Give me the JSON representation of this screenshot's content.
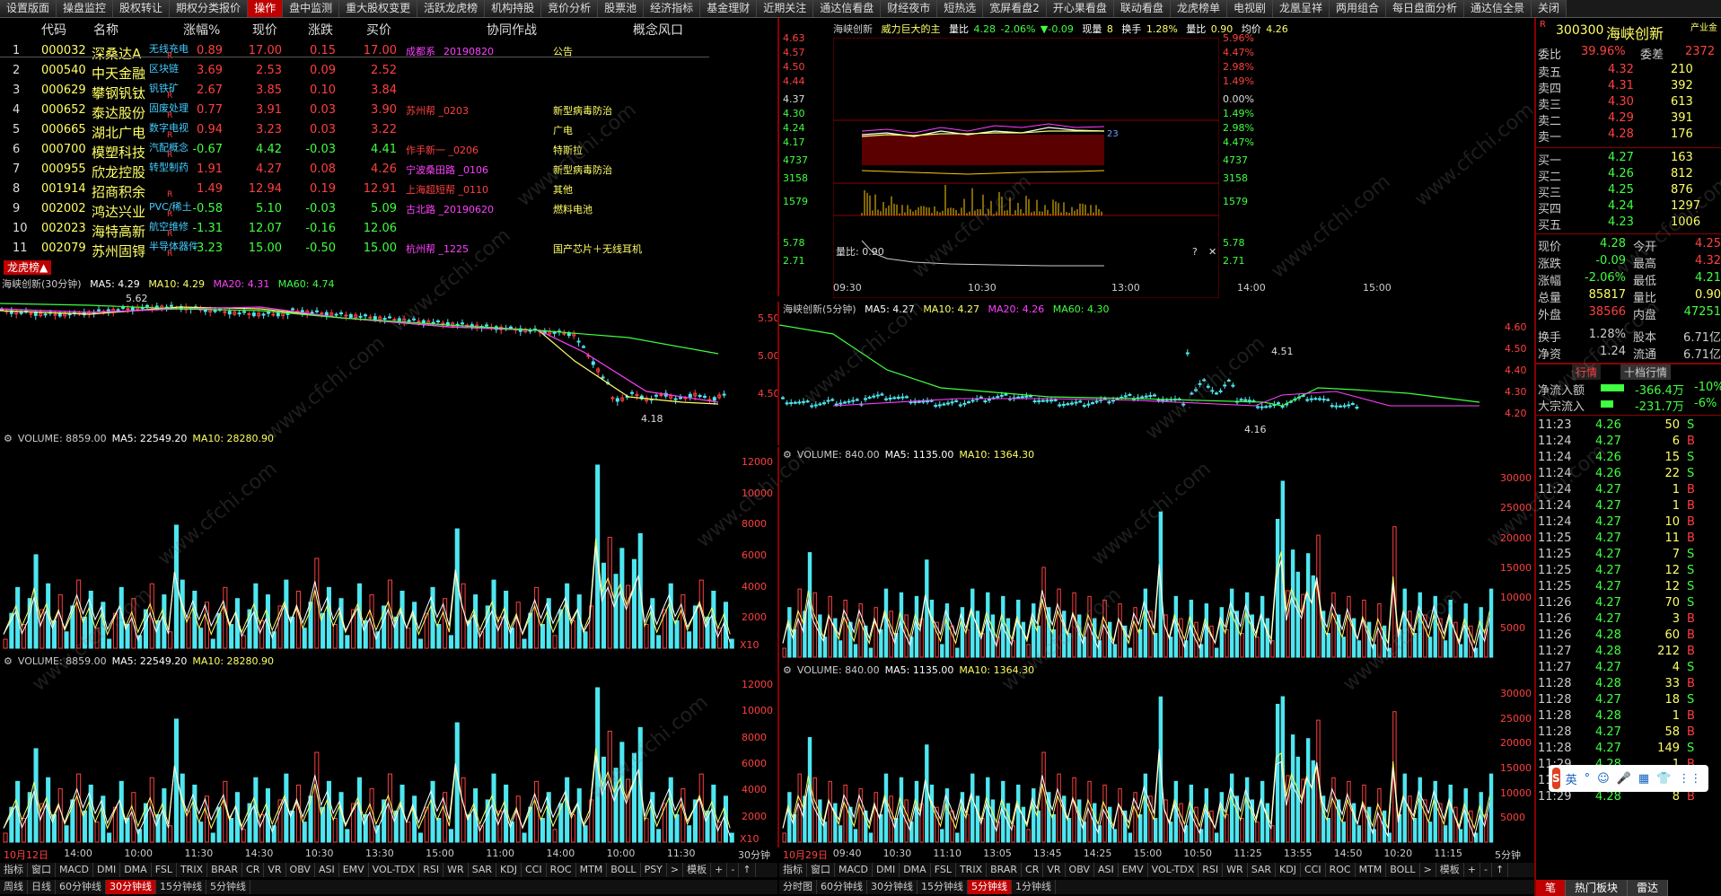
{
  "topbar": [
    "设置版面",
    "操盘监控",
    "股权转让",
    "期权分类报价",
    "操作",
    "盘中监测",
    "重大股权变更",
    "活跃龙虎榜",
    "机构持股",
    "竞价分析",
    "股票池",
    "经济指标",
    "基金理财",
    "近期关注",
    "通达信看盘",
    "财经夜市",
    "短热选",
    "宽屏看盘2",
    "开心果看盘",
    "联动看盘",
    "龙虎榜单",
    "电视剧",
    "龙凰呈祥",
    "两用组合",
    "每日盘面分析",
    "通达信全景",
    "关闭"
  ],
  "lhb": {
    "headers": [
      "代码",
      "名称",
      "涨幅%",
      "现价",
      "涨跌",
      "买价",
      "协同作战",
      "概念风口"
    ],
    "rows": [
      {
        "i": "1",
        "code": "000032",
        "name": "深桑达A",
        "note": "无线充电",
        "r": "R",
        "pct": "0.89",
        "px": "17.00",
        "chg": "0.15",
        "bid": "17.00",
        "syn": "成都系 _20190820",
        "con": "公告",
        "c": "up"
      },
      {
        "i": "2",
        "code": "000540",
        "name": "中天金融",
        "note": "区块链",
        "r": "",
        "pct": "3.69",
        "px": "2.53",
        "chg": "0.09",
        "bid": "2.52",
        "syn": "",
        "con": "",
        "c": "up"
      },
      {
        "i": "3",
        "code": "000629",
        "name": "攀钢钒钛",
        "note": "钒铁矿",
        "r": "R",
        "pct": "2.67",
        "px": "3.85",
        "chg": "0.10",
        "bid": "3.84",
        "syn": "",
        "con": "",
        "c": "up"
      },
      {
        "i": "4",
        "code": "000652",
        "name": "泰达股份",
        "note": "固废处理",
        "r": "R",
        "pct": "0.77",
        "px": "3.91",
        "chg": "0.03",
        "bid": "3.90",
        "syn": "苏州帮 _0203",
        "con": "新型病毒防治",
        "c": "up"
      },
      {
        "i": "5",
        "code": "000665",
        "name": "湖北广电",
        "note": "数字电视",
        "r": "R",
        "pct": "0.94",
        "px": "3.23",
        "chg": "0.03",
        "bid": "3.22",
        "syn": "",
        "con": "广电",
        "c": "up"
      },
      {
        "i": "6",
        "code": "000700",
        "name": "模塑科技",
        "note": "汽配概念",
        "r": "R",
        "pct": "-0.67",
        "px": "4.42",
        "chg": "-0.03",
        "bid": "4.41",
        "syn": "作手新一 _0206",
        "con": "特斯拉",
        "c": "dn"
      },
      {
        "i": "7",
        "code": "000955",
        "name": "欣龙控股",
        "note": "转型制药",
        "r": "",
        "pct": "1.91",
        "px": "4.27",
        "chg": "0.08",
        "bid": "4.26",
        "syn": "宁波桑田路 _0106",
        "con": "新型病毒防治",
        "c": "up"
      },
      {
        "i": "8",
        "code": "001914",
        "name": "招商积余",
        "note": "",
        "r": "R",
        "pct": "1.49",
        "px": "12.94",
        "chg": "0.19",
        "bid": "12.91",
        "syn": "上海超短帮 _0110",
        "con": "其他",
        "c": "up"
      },
      {
        "i": "9",
        "code": "002002",
        "name": "鸿达兴业",
        "note": "PVC/稀土",
        "r": "R",
        "pct": "-0.58",
        "px": "5.10",
        "chg": "-0.03",
        "bid": "5.09",
        "syn": "古北路 _20190620",
        "con": "燃料电池",
        "c": "dn"
      },
      {
        "i": "10",
        "code": "002023",
        "name": "海特高新",
        "note": "航空维修",
        "r": "R",
        "pct": "-1.31",
        "px": "12.07",
        "chg": "-0.16",
        "bid": "12.06",
        "syn": "",
        "con": "",
        "c": "dn"
      },
      {
        "i": "11",
        "code": "002079",
        "name": "苏州固锝",
        "note": "半导体器件",
        "r": "R",
        "pct": "-3.23",
        "px": "15.00",
        "chg": "-0.50",
        "bid": "15.00",
        "syn": "杭州帮 _1225",
        "con": "国产芯片＋无线耳机",
        "c": "dn"
      }
    ],
    "tag": "龙虎榜▲"
  },
  "intraday": {
    "title": "海峡创新",
    "subtitle": "威力巨大的主",
    "vr_label": "量比",
    "price": "4.28",
    "pct": "-2.06%",
    "chg": "▼-0.09",
    "cur_vol_label": "现量",
    "cur_vol": "8",
    "turn_label": "换手",
    "turn": "1.28%",
    "vr_label2": "量比",
    "vr": "0.90",
    "avg_label": "均价",
    "avg": "4.26",
    "left_axis": [
      "4.63",
      "4.57",
      "4.50",
      "4.44",
      "4.37",
      "4.30",
      "4.24",
      "4.17",
      "4737",
      "3158",
      "1579",
      "5.78",
      "2.71"
    ],
    "right_axis": [
      "5.96%",
      "4.47%",
      "2.98%",
      "1.49%",
      "0.00%",
      "1.49%",
      "2.98%",
      "4.47%",
      "4737",
      "3158",
      "1579",
      "5.78",
      "2.71"
    ],
    "vr_title": "量比: 0.90",
    "help": "?",
    "close": "✕",
    "times": [
      "09:30",
      "10:30",
      "13:00",
      "14:00",
      "15:00"
    ],
    "marker": "23"
  },
  "k30": {
    "title": "海峡创新(30分钟)",
    "ma5": "MA5: 4.29",
    "ma10": "MA10: 4.29",
    "ma20": "MA20: 4.31",
    "ma60": "MA60: 4.74",
    "axis": [
      "5.50",
      "5.00",
      "4.50"
    ],
    "hi": "5.62",
    "lo": "4.18"
  },
  "k5": {
    "title": "海峡创新(5分钟)",
    "ma5": "MA5: 4.27",
    "ma10": "MA10: 4.27",
    "ma20": "MA20: 4.26",
    "ma60": "MA60: 4.30",
    "axis": [
      "4.60",
      "4.50",
      "4.40",
      "4.30",
      "4.20"
    ],
    "hi": "4.51",
    "lo": "4.16"
  },
  "vol30": {
    "label": "VOLUME: 8859.00",
    "ma5": "MA5: 22549.20",
    "ma10": "MA10: 28280.90",
    "axis": [
      "12000",
      "10000",
      "8000",
      "6000",
      "4000",
      "2000"
    ],
    "unit": "X10"
  },
  "vol5": {
    "label": "VOLUME: 840.00",
    "ma5": "MA5: 1135.00",
    "ma10": "MA10: 1364.30",
    "axis": [
      "30000",
      "25000",
      "20000",
      "15000",
      "10000",
      "5000"
    ]
  },
  "left_time": [
    "10月12日",
    "14:00",
    "10:00",
    "11:30",
    "14:30",
    "10:30",
    "13:30",
    "15:00",
    "11:00",
    "14:00",
    "10:00",
    "11:30"
  ],
  "left_period": "30分钟",
  "right_time": [
    "10月29日",
    "09:40",
    "10:30",
    "11:10",
    "13:05",
    "13:45",
    "14:25",
    "15:00",
    "10:50",
    "11:25",
    "13:55",
    "14:50",
    "10:20",
    "11:15"
  ],
  "right_period": "5分钟",
  "indicators": [
    "指标",
    "窗口",
    "MACD",
    "DMI",
    "DMA",
    "FSL",
    "TRIX",
    "BRAR",
    "CR",
    "VR",
    "OBV",
    "ASI",
    "EMV",
    "VOL-TDX",
    "RSI",
    "WR",
    "SAR",
    "KDJ",
    "CCI",
    "ROC",
    "MTM",
    "BOLL",
    "PSY",
    ">",
    "模板",
    "+",
    "-",
    "↑"
  ],
  "indicators_r": [
    "指标",
    "窗口",
    "MACD",
    "DMI",
    "DMA",
    "FSL",
    "TRIX",
    "BRAR",
    "CR",
    "VR",
    "OBV",
    "ASI",
    "EMV",
    "VOL-TDX",
    "RSI",
    "WR",
    "SAR",
    "KDJ",
    "CCI",
    "ROC",
    "MTM",
    "BOLL",
    ">",
    "模板",
    "+",
    "-",
    "↑"
  ],
  "periods_l": [
    "周线",
    "日线",
    "60分钟线",
    "30分钟线",
    "15分钟线",
    "5分钟线"
  ],
  "periods_r": [
    "分时图",
    "60分钟线",
    "30分钟线",
    "15分钟线",
    "5分钟线",
    "1分钟线"
  ],
  "quote": {
    "code": "300300",
    "name": "海峡创新",
    "tag": "产业金",
    "r": "R",
    "wb_label": "委比",
    "wb": "39.96%",
    "wc_label": "委差",
    "wc": "2372",
    "asks": [
      [
        "卖五",
        "4.32",
        "210"
      ],
      [
        "卖四",
        "4.31",
        "392"
      ],
      [
        "卖三",
        "4.30",
        "613"
      ],
      [
        "卖二",
        "4.29",
        "391"
      ],
      [
        "卖一",
        "4.28",
        "176"
      ]
    ],
    "bids": [
      [
        "买一",
        "4.27",
        "163"
      ],
      [
        "买二",
        "4.26",
        "812"
      ],
      [
        "买三",
        "4.25",
        "876"
      ],
      [
        "买四",
        "4.24",
        "1297"
      ],
      [
        "买五",
        "4.23",
        "1006"
      ]
    ],
    "stats": [
      [
        "现价",
        "4.28",
        "今开",
        "4.25"
      ],
      [
        "涨跌",
        "-0.09",
        "最高",
        "4.32"
      ],
      [
        "涨幅",
        "-2.06%",
        "最低",
        "4.21"
      ],
      [
        "总量",
        "85817",
        "量比",
        "0.90"
      ],
      [
        "外盘",
        "38566",
        "内盘",
        "47251"
      ],
      [
        "换手",
        "1.28%",
        "股本",
        "6.71亿"
      ],
      [
        "净资",
        "1.24",
        "流通",
        "6.71亿"
      ]
    ],
    "tabs": [
      "行情",
      "十档行情"
    ],
    "flow": [
      [
        "净流入额",
        "-366.4万",
        "-10%"
      ],
      [
        "大宗流入",
        "-231.7万",
        "-6%"
      ]
    ],
    "ticks": [
      [
        "11:23",
        "4.26",
        "50",
        "S"
      ],
      [
        "11:24",
        "4.27",
        "6",
        "B"
      ],
      [
        "11:24",
        "4.26",
        "15",
        "S"
      ],
      [
        "11:24",
        "4.26",
        "22",
        "S"
      ],
      [
        "11:24",
        "4.27",
        "1",
        "B"
      ],
      [
        "11:24",
        "4.27",
        "1",
        "B"
      ],
      [
        "11:24",
        "4.27",
        "10",
        "B"
      ],
      [
        "11:25",
        "4.27",
        "11",
        "B"
      ],
      [
        "11:25",
        "4.27",
        "7",
        "S"
      ],
      [
        "11:25",
        "4.27",
        "12",
        "S"
      ],
      [
        "11:25",
        "4.27",
        "12",
        "S"
      ],
      [
        "11:26",
        "4.27",
        "70",
        "S"
      ],
      [
        "11:26",
        "4.27",
        "3",
        "B"
      ],
      [
        "11:26",
        "4.28",
        "60",
        "B"
      ],
      [
        "11:27",
        "4.28",
        "212",
        "B"
      ],
      [
        "11:27",
        "4.27",
        "4",
        "S"
      ],
      [
        "11:28",
        "4.28",
        "33",
        "B"
      ],
      [
        "11:28",
        "4.27",
        "18",
        "S"
      ],
      [
        "11:28",
        "4.28",
        "1",
        "B"
      ],
      [
        "11:28",
        "4.27",
        "58",
        "B"
      ],
      [
        "11:28",
        "4.27",
        "149",
        "S"
      ],
      [
        "11:29",
        "4.28",
        "1",
        "B"
      ],
      [
        "11:29",
        "4.28",
        "3",
        "B"
      ],
      [
        "11:29",
        "4.28",
        "8",
        "B"
      ]
    ],
    "bottom_tabs": [
      "笔",
      "热门板块",
      "雷达"
    ],
    "ime": [
      "英",
      "°",
      "☺",
      "🎤",
      "▦",
      "👕",
      "⋮⋮"
    ]
  },
  "watermark": "www.cfchi.com",
  "colors": {
    "up": "#ff4040",
    "down": "#40ff40",
    "accent": "#c00000",
    "yellow": "#ffff66",
    "cyan": "#4ee6f0"
  }
}
